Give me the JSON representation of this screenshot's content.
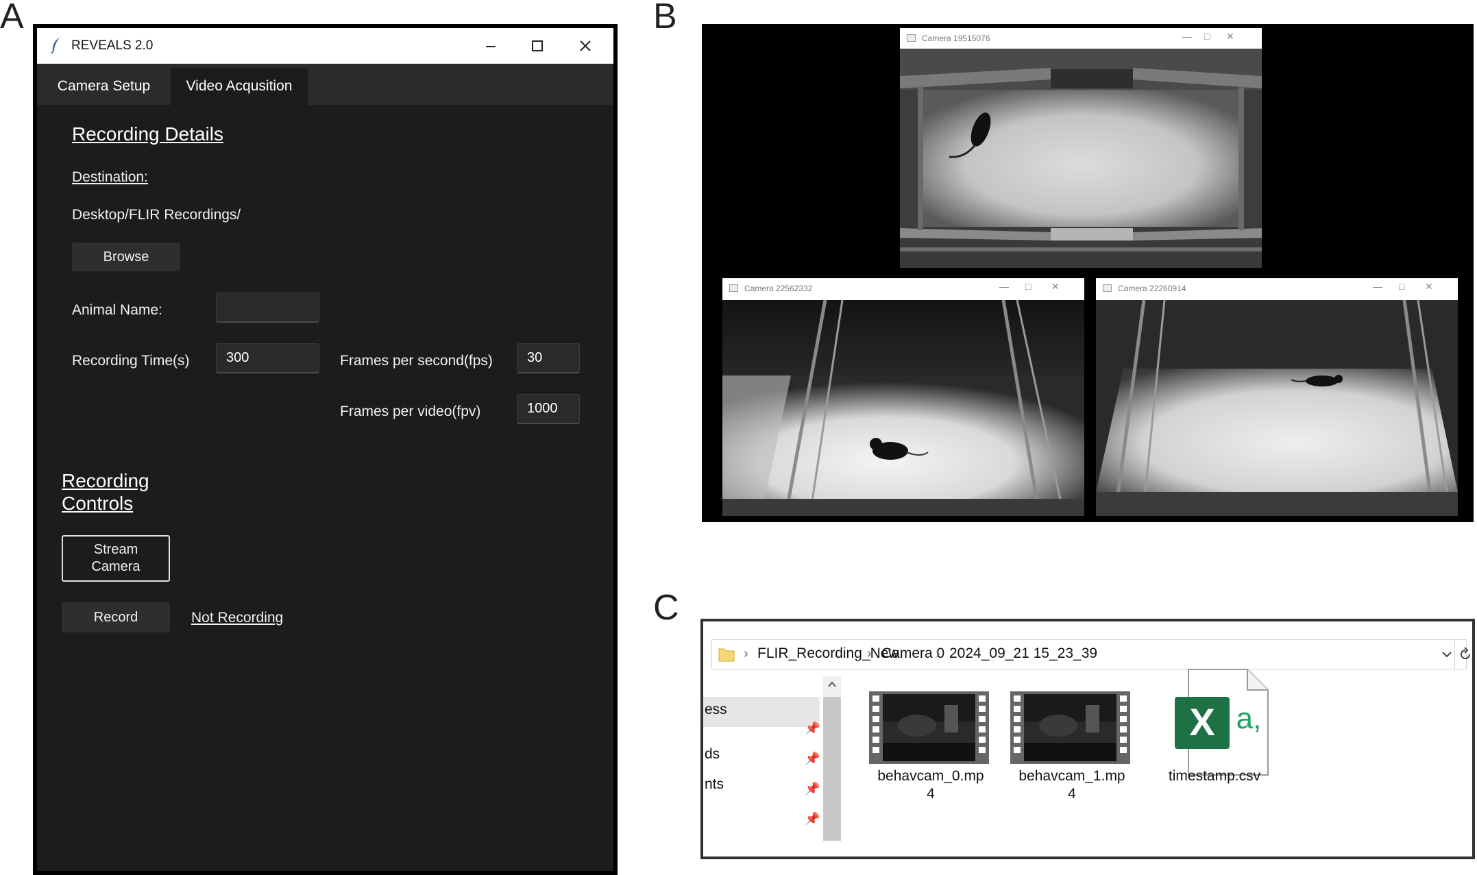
{
  "panels": {
    "a": "A",
    "b": "B",
    "c": "C"
  },
  "app": {
    "title": "REVEALS 2.0",
    "tabs": [
      "Camera Setup",
      "Video Acqusition"
    ],
    "active_tab": "Video Acqusition",
    "recording_details": {
      "heading": "Recording Details",
      "destination_label": "Destination:",
      "destination_path": "Desktop/FLIR Recordings/",
      "browse_label": "Browse",
      "animal_name_label": "Animal Name:",
      "animal_name_value": "",
      "recording_time_label": "Recording Time(s)",
      "recording_time_value": "300",
      "fps_label": "Frames per second(fps)",
      "fps_value": "30",
      "fpv_label": "Frames per video(fpv)",
      "fpv_value": "1000"
    },
    "recording_controls": {
      "heading_line1": "Recording",
      "heading_line2": "Controls",
      "stream_line1": "Stream",
      "stream_line2": "Camera",
      "record_label": "Record",
      "status": "Not Recording"
    }
  },
  "cameras": [
    {
      "title": "Camera 19515076"
    },
    {
      "title": "Camera 22562332"
    },
    {
      "title": "Camera 22260914"
    }
  ],
  "explorer": {
    "breadcrumb": [
      "FLIR_Recording_New",
      "Camera 0",
      "2024_09_21 15_23_39"
    ],
    "nav_fragments": [
      "ess",
      "ds",
      "nts"
    ],
    "files": [
      {
        "name_line1": "behavcam_0.mp",
        "name_line2": "4",
        "icon": "video-file-icon"
      },
      {
        "name_line1": "behavcam_1.mp",
        "name_line2": "4",
        "icon": "video-file-icon"
      },
      {
        "name_line1": "timestamp.csv",
        "name_line2": "",
        "icon": "excel-csv-icon"
      }
    ],
    "excel_glyph": "X",
    "excel_sub": "a,"
  },
  "colors": {
    "app_bg": "#1c1c1c",
    "excel_green": "#1e7145",
    "excel_accent": "#21a366"
  }
}
